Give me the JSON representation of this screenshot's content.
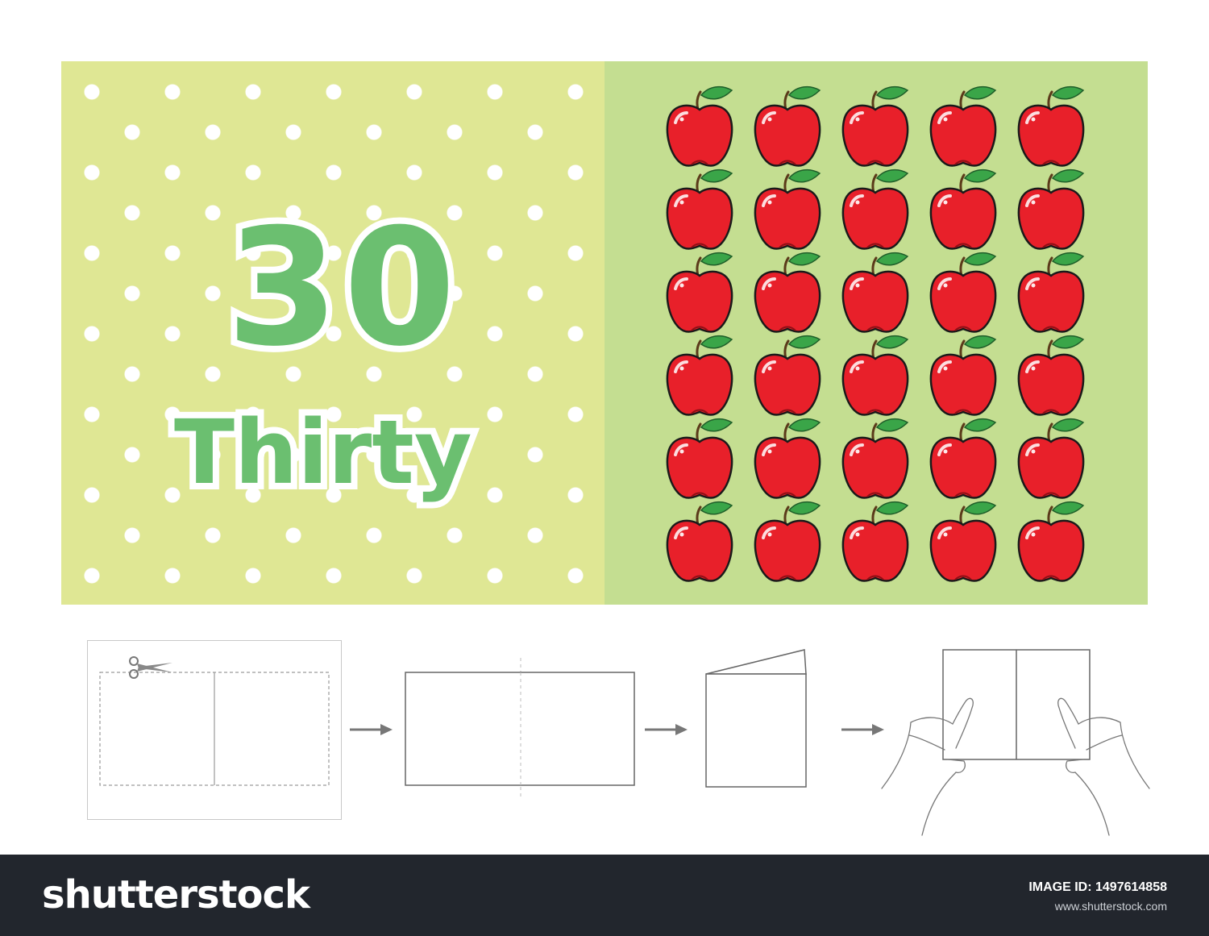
{
  "card": {
    "number": "30",
    "word": "Thirty",
    "apple_count": 30,
    "colors": {
      "left_bg": "#dfe794",
      "right_bg": "#c4de91",
      "number_text": "#6bbf70",
      "apple_red": "#e8202a",
      "leaf_green": "#3aa548"
    }
  },
  "instructions": {
    "steps": [
      {
        "name": "cut",
        "icon": "scissors-icon"
      },
      {
        "name": "unfolded-sheet",
        "icon": "sheet-icon"
      },
      {
        "name": "fold",
        "icon": "folded-card-icon"
      },
      {
        "name": "open-book",
        "icon": "hands-holding-book-icon"
      }
    ],
    "arrow_icon": "arrow-right-icon"
  },
  "footer": {
    "logo": "shutterstock",
    "image_id": "IMAGE ID: 1497614858",
    "url": "www.shutterstock.com"
  }
}
